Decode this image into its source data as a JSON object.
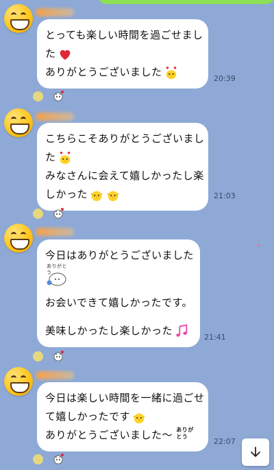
{
  "messages": [
    {
      "lines": [
        "とっても楽しい時間を過ごせまし",
        "た",
        "ありがとうございました"
      ],
      "time": "20:39"
    },
    {
      "lines": [
        "こちらこそありがとうございまし",
        "た",
        "みなさんに会えて嬉しかったし楽",
        "しかった"
      ],
      "time": "21:03"
    },
    {
      "lines": [
        "今日はありがとうございました",
        "お会いできて嬉しかったです。",
        "美味しかったし楽しかった"
      ],
      "sticker_text": "ありがとう",
      "time": "21:41"
    },
    {
      "lines": [
        "今日は楽しい時間を一緒に過ごせ",
        "て嬉しかったです",
        "ありがとうございました〜"
      ],
      "sticker_text": "ありが とう",
      "time": "22:07"
    }
  ],
  "colors": {
    "background": "#8ea9d6",
    "bubble": "#ffffff",
    "sent_bubble": "#8de055"
  },
  "icons": [
    "grinning-face-avatar",
    "red-heart-emoji",
    "chick-heart-emoji",
    "chick-emoji",
    "music-note-emoji",
    "arigatou-sticker",
    "scroll-down-arrow"
  ]
}
